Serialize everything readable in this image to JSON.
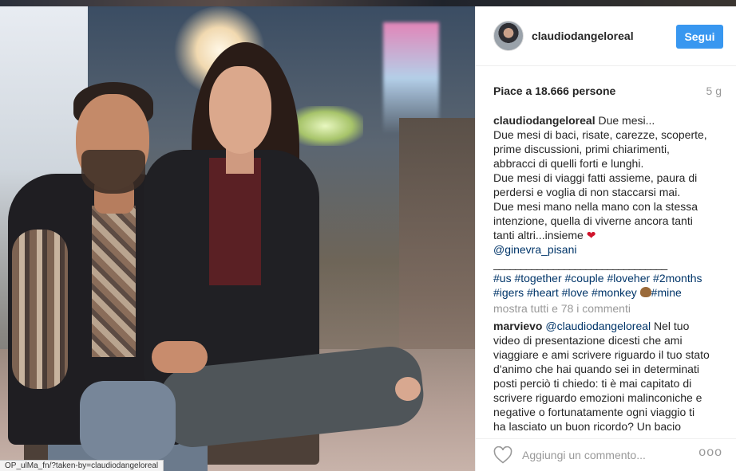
{
  "photo": {
    "status_url": "OP_ulMa_fn/?taken-by=claudiodangeloreal"
  },
  "post": {
    "username": "claudiodangeloreal",
    "follow_label": "Segui",
    "likes_text": "Piace a 18.666 persone",
    "age": "5 g"
  },
  "caption": {
    "author": "claudiodangeloreal",
    "first_line": "Due mesi...",
    "lines": [
      "Due mesi di baci, risate, carezze, scoperte,",
      "prime discussioni, primi chiarimenti,",
      "abbracci di quelli forti e lunghi.",
      "Due mesi di viaggi fatti assieme, paura di",
      "perdersi e voglia di non staccarsi mai.",
      "Due mesi mano nella mano con la stessa",
      "intenzione, quella di viverne ancora tanti"
    ],
    "last_line": "tanti altri...insieme",
    "mention": "@ginevra_pisani",
    "divider": "________________________________",
    "tags_line1": "#us #together #couple #loveher #2months",
    "tags_line2": "#igers #heart #love #monkey",
    "tags_line2_end": "#mine",
    "heart_glyph": "❤",
    "heart_color": "#d0142c"
  },
  "comments": {
    "show_all": "mostra tutti e 78 i commenti",
    "items": [
      {
        "author": "marvievo",
        "mention": "@claudiodangeloreal",
        "first_tail": " Nel tuo",
        "lines": [
          "video di presentazione dicesti che ami",
          "viaggiare e ami scrivere riguardo il tuo stato",
          "d'animo che hai quando sei in determinati",
          "posti perciò ti chiedo: ti è mai capitato di",
          "scrivere riguardo emozioni malinconiche e",
          "negative o fortunatamente ogni viaggio ti",
          "ha lasciato un buon ricordo? Un bacio"
        ]
      }
    ]
  },
  "footer": {
    "comment_placeholder": "Aggiungi un commento...",
    "more_glyph": "ooo"
  },
  "colors": {
    "accent": "#3897f0",
    "link": "#003569",
    "muted": "#999999"
  }
}
